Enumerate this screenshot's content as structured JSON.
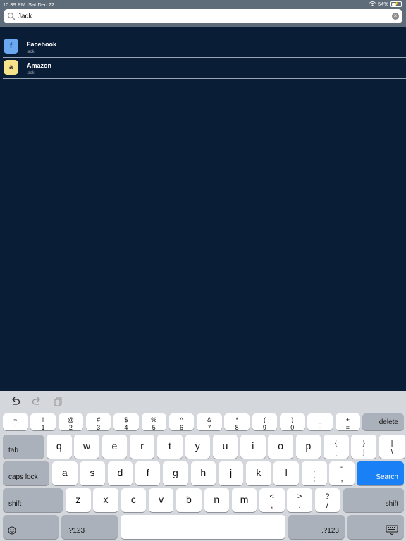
{
  "status": {
    "time": "10:39 PM",
    "date": "Sat Dec 22",
    "battery": "54%",
    "battery_level": 0.54
  },
  "search": {
    "value": "Jack",
    "placeholder": "Search"
  },
  "results": [
    {
      "title": "Facebook",
      "subtitle": "jack",
      "icon_letter": "f",
      "icon_bg": "#6aa9f0",
      "icon_fg": "#1e3c7a"
    },
    {
      "title": "Amazon",
      "subtitle": "jack",
      "icon_letter": "a",
      "icon_bg": "#f5e28a",
      "icon_fg": "#333333"
    }
  ],
  "keyboard": {
    "number_row": [
      {
        "top": "~",
        "bot": "`"
      },
      {
        "top": "!",
        "bot": "1"
      },
      {
        "top": "@",
        "bot": "2"
      },
      {
        "top": "#",
        "bot": "3"
      },
      {
        "top": "$",
        "bot": "4"
      },
      {
        "top": "%",
        "bot": "5"
      },
      {
        "top": "^",
        "bot": "6"
      },
      {
        "top": "&",
        "bot": "7"
      },
      {
        "top": "*",
        "bot": "8"
      },
      {
        "top": "(",
        "bot": "9"
      },
      {
        "top": ")",
        "bot": "0"
      },
      {
        "top": "_",
        "bot": "-"
      },
      {
        "top": "+",
        "bot": "="
      }
    ],
    "delete": "delete",
    "tab": "tab",
    "row_q": [
      "q",
      "w",
      "e",
      "r",
      "t",
      "y",
      "u",
      "i",
      "o",
      "p"
    ],
    "row_q_punct": [
      {
        "top": "{",
        "bot": "["
      },
      {
        "top": "}",
        "bot": "]"
      },
      {
        "top": "|",
        "bot": "\\"
      }
    ],
    "caps": "caps lock",
    "row_a": [
      "a",
      "s",
      "d",
      "f",
      "g",
      "h",
      "j",
      "k",
      "l"
    ],
    "row_a_punct": [
      {
        "top": ":",
        "bot": ";"
      },
      {
        "top": "\"",
        "bot": ","
      }
    ],
    "search": "Search",
    "shift": "shift",
    "row_z": [
      "z",
      "x",
      "c",
      "v",
      "b",
      "n",
      "m"
    ],
    "row_z_punct": [
      {
        "top": "<",
        "bot": ","
      },
      {
        "top": ">",
        "bot": "."
      },
      {
        "top": "?",
        "bot": "/"
      }
    ],
    "numbers_key": ".?123",
    "emoji_icon": "emoji-icon",
    "hide_keyboard_icon": "keyboard-hide-icon"
  },
  "colors": {
    "background": "#0a1d36",
    "header": "#5e6b78",
    "accent": "#1a80f6"
  }
}
